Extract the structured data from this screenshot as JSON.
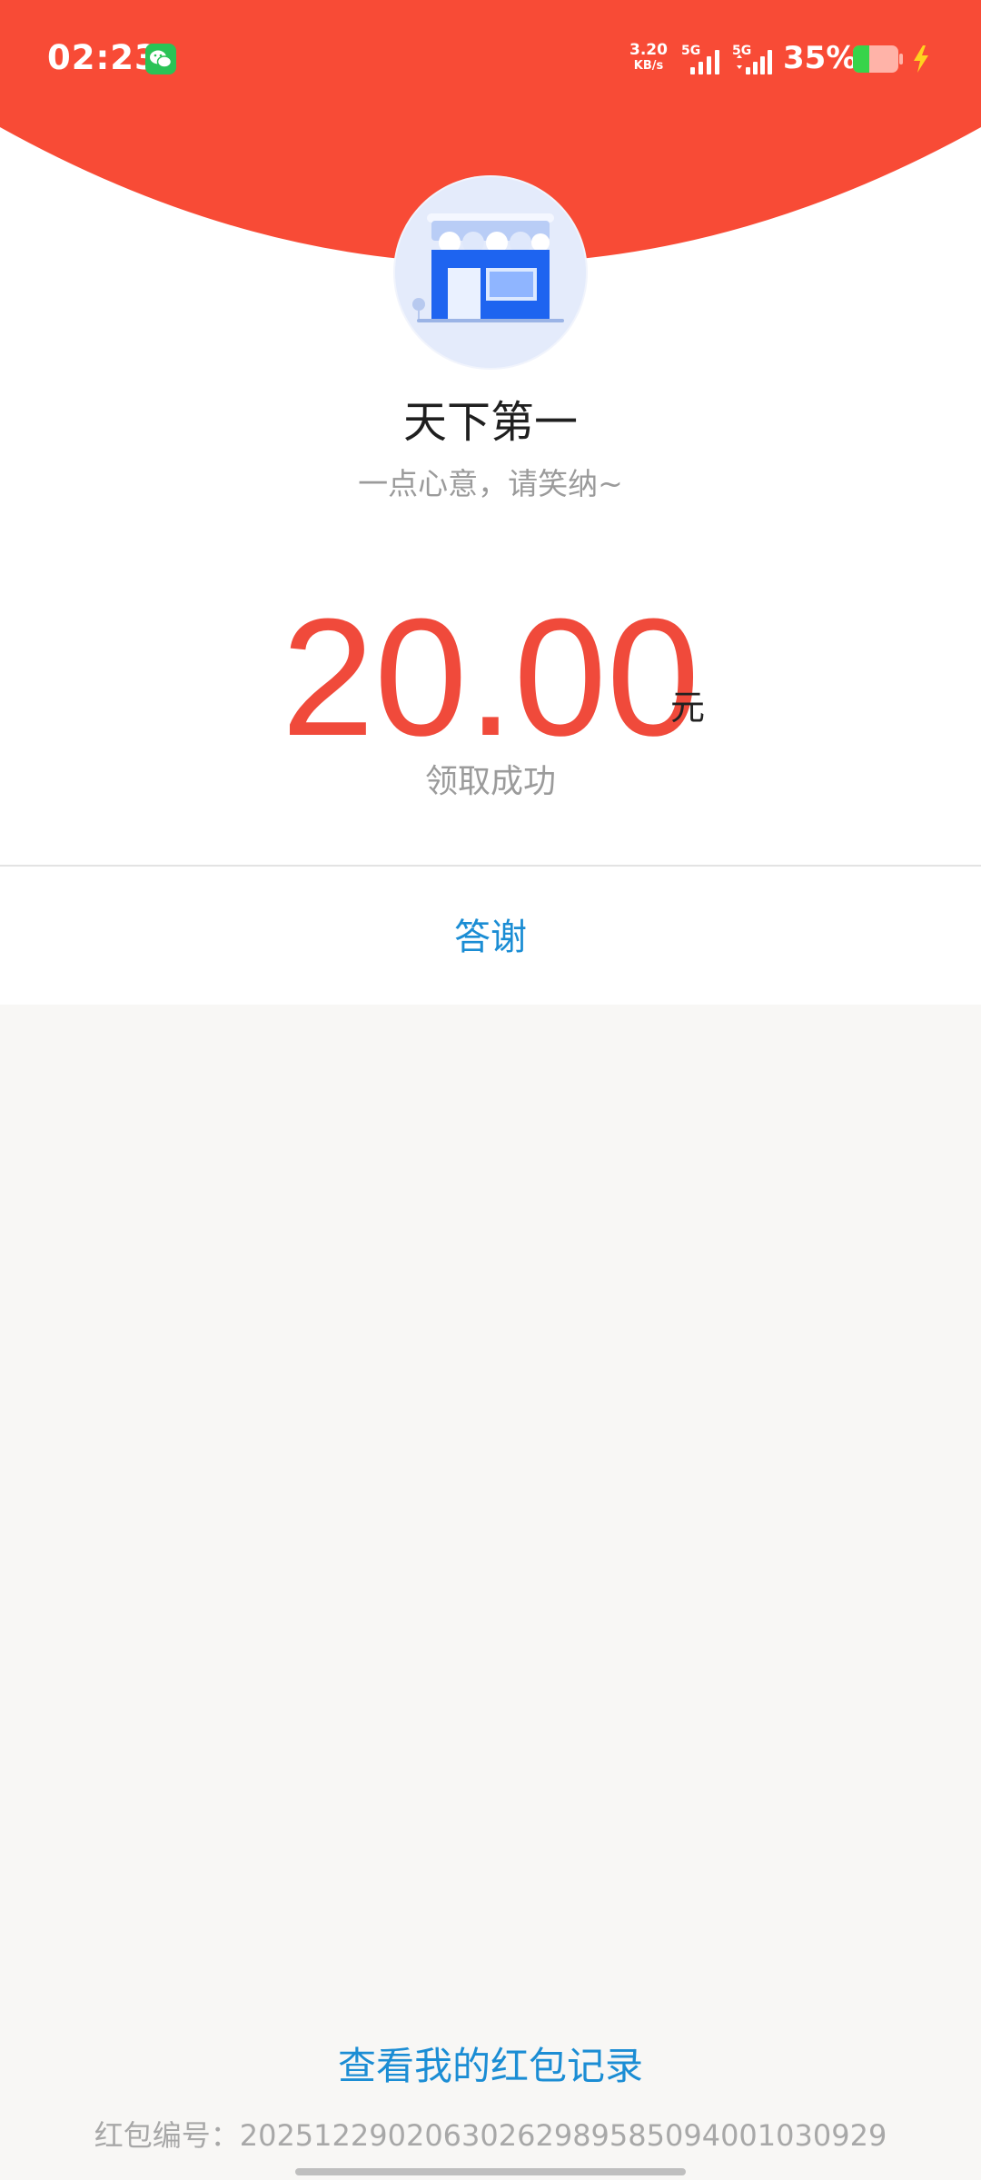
{
  "status_bar": {
    "time": "02:23",
    "net_speed_value": "3.20",
    "net_speed_unit": "KB/s",
    "sim1_network": "5G",
    "sim2_network": "5G",
    "battery_percent": "35%",
    "notification_icon": "wechat-icon",
    "charging_icon": "charging-bolt-icon"
  },
  "sender": {
    "avatar_icon": "storefront-icon",
    "name": "天下第一",
    "greeting": "一点心意，请笑纳~"
  },
  "red_packet": {
    "amount": "20.00",
    "unit": "元",
    "status": "领取成功"
  },
  "actions": {
    "thanks_label": "答谢",
    "records_label": "查看我的红包记录"
  },
  "footer": {
    "serial_label": "红包编号：",
    "serial_number": "20251229020630262989585094001030929"
  },
  "colors": {
    "header_red": "#f84b36",
    "amount_red": "#f04a3b",
    "link_blue": "#1b8dd4",
    "page_background": "#f8f7f5"
  }
}
